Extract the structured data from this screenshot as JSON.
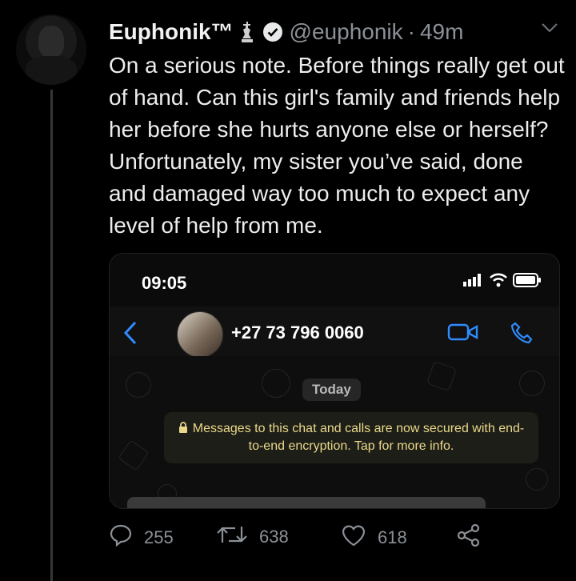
{
  "tweet": {
    "author_name": "Euphonik™",
    "handle": "@euphonik",
    "separator": "·",
    "time": "49m",
    "text": "On a serious note. Before things really get out of hand. Can this girl's family and friends help her before she hurts anyone else or herself? Unfortunately, my sister you’ve said, done and damaged way too much to expect any level of help from me.",
    "icons": [
      "chess-king-icon",
      "verified-badge-icon",
      "chevron-down-icon"
    ]
  },
  "media": {
    "status_time": "09:05",
    "contact_number": "+27 73 796 0060",
    "date_badge": "Today",
    "encryption_notice": "Messages to this chat and calls are now secured with end-to-end encryption. Tap for more info.",
    "icons": [
      "signal-icon",
      "wifi-icon",
      "battery-icon",
      "back-chevron-icon",
      "video-call-icon",
      "phone-call-icon",
      "lock-icon"
    ]
  },
  "actions": {
    "replies": "255",
    "retweets": "638",
    "likes": "618",
    "icons": [
      "reply-icon",
      "retweet-icon",
      "like-icon",
      "share-icon"
    ]
  },
  "colors": {
    "background": "#000000",
    "text": "#e7e9ea",
    "muted": "#8b9197",
    "ios_blue": "#2f8cff",
    "notice_yellow": "#e9d88a"
  }
}
